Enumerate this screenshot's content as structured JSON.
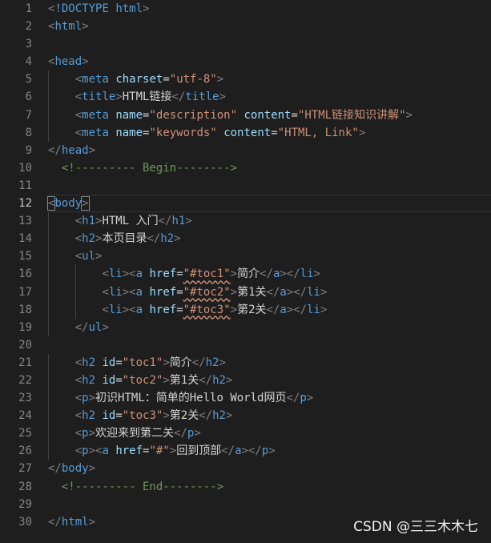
{
  "lines": [
    {
      "n": "1",
      "t": [
        [
          "punc",
          "<"
        ],
        [
          "doctype",
          "!DOCTYPE"
        ],
        [
          "txt",
          " "
        ],
        [
          "tag",
          "html"
        ],
        [
          "punc",
          ">"
        ]
      ]
    },
    {
      "n": "2",
      "t": [
        [
          "punc",
          "<"
        ],
        [
          "tag",
          "html"
        ],
        [
          "punc",
          ">"
        ]
      ]
    },
    {
      "n": "3",
      "t": []
    },
    {
      "n": "4",
      "t": [
        [
          "punc",
          "<"
        ],
        [
          "tag",
          "head"
        ],
        [
          "punc",
          ">"
        ]
      ]
    },
    {
      "n": "5",
      "t": [
        [
          "txt",
          "    "
        ],
        [
          "punc",
          "<"
        ],
        [
          "tag",
          "meta"
        ],
        [
          "txt",
          " "
        ],
        [
          "attr",
          "charset"
        ],
        [
          "txt",
          "="
        ],
        [
          "str",
          "\"utf-8\""
        ],
        [
          "punc",
          ">"
        ]
      ]
    },
    {
      "n": "6",
      "t": [
        [
          "txt",
          "    "
        ],
        [
          "punc",
          "<"
        ],
        [
          "tag",
          "title"
        ],
        [
          "punc",
          ">"
        ],
        [
          "txt",
          "HTML链接"
        ],
        [
          "punc",
          "</"
        ],
        [
          "tag",
          "title"
        ],
        [
          "punc",
          ">"
        ]
      ]
    },
    {
      "n": "7",
      "t": [
        [
          "txt",
          "    "
        ],
        [
          "punc",
          "<"
        ],
        [
          "tag",
          "meta"
        ],
        [
          "txt",
          " "
        ],
        [
          "attr",
          "name"
        ],
        [
          "txt",
          "="
        ],
        [
          "str",
          "\"description\""
        ],
        [
          "txt",
          " "
        ],
        [
          "attr",
          "content"
        ],
        [
          "txt",
          "="
        ],
        [
          "str",
          "\"HTML链接知识讲解\""
        ],
        [
          "punc",
          ">"
        ]
      ]
    },
    {
      "n": "8",
      "t": [
        [
          "txt",
          "    "
        ],
        [
          "punc",
          "<"
        ],
        [
          "tag",
          "meta"
        ],
        [
          "txt",
          " "
        ],
        [
          "attr",
          "name"
        ],
        [
          "txt",
          "="
        ],
        [
          "str",
          "\"keywords\""
        ],
        [
          "txt",
          " "
        ],
        [
          "attr",
          "content"
        ],
        [
          "txt",
          "="
        ],
        [
          "str",
          "\"HTML, Link\""
        ],
        [
          "punc",
          ">"
        ]
      ]
    },
    {
      "n": "9",
      "t": [
        [
          "punc",
          "</"
        ],
        [
          "tag",
          "head"
        ],
        [
          "punc",
          ">"
        ]
      ]
    },
    {
      "n": "10",
      "t": [
        [
          "txt",
          "  "
        ],
        [
          "cmt",
          "<!--------- Begin-------->"
        ]
      ]
    },
    {
      "n": "11",
      "t": []
    },
    {
      "n": "12",
      "active": true,
      "t": [
        [
          "punc bracket-hl",
          "<"
        ],
        [
          "tag",
          "body"
        ],
        [
          "punc bracket-hl",
          ">"
        ]
      ]
    },
    {
      "n": "13",
      "t": [
        [
          "txt",
          "    "
        ],
        [
          "punc",
          "<"
        ],
        [
          "tag",
          "h1"
        ],
        [
          "punc",
          ">"
        ],
        [
          "txt",
          "HTML 入门"
        ],
        [
          "punc",
          "</"
        ],
        [
          "tag",
          "h1"
        ],
        [
          "punc",
          ">"
        ]
      ]
    },
    {
      "n": "14",
      "t": [
        [
          "txt",
          "    "
        ],
        [
          "punc",
          "<"
        ],
        [
          "tag",
          "h2"
        ],
        [
          "punc",
          ">"
        ],
        [
          "txt",
          "本页目录"
        ],
        [
          "punc",
          "</"
        ],
        [
          "tag",
          "h2"
        ],
        [
          "punc",
          ">"
        ]
      ]
    },
    {
      "n": "15",
      "t": [
        [
          "txt",
          "    "
        ],
        [
          "punc",
          "<"
        ],
        [
          "tag",
          "ul"
        ],
        [
          "punc",
          ">"
        ]
      ]
    },
    {
      "n": "16",
      "t": [
        [
          "txt",
          "        "
        ],
        [
          "punc",
          "<"
        ],
        [
          "tag",
          "li"
        ],
        [
          "punc",
          "><"
        ],
        [
          "tag",
          "a"
        ],
        [
          "txt",
          " "
        ],
        [
          "attr",
          "href"
        ],
        [
          "txt",
          "="
        ],
        [
          "str squig",
          "\"#toc1\""
        ],
        [
          "punc",
          ">"
        ],
        [
          "txt",
          "简介"
        ],
        [
          "punc",
          "</"
        ],
        [
          "tag",
          "a"
        ],
        [
          "punc",
          "></"
        ],
        [
          "tag",
          "li"
        ],
        [
          "punc",
          ">"
        ]
      ]
    },
    {
      "n": "17",
      "t": [
        [
          "txt",
          "        "
        ],
        [
          "punc",
          "<"
        ],
        [
          "tag",
          "li"
        ],
        [
          "punc",
          "><"
        ],
        [
          "tag",
          "a"
        ],
        [
          "txt",
          " "
        ],
        [
          "attr",
          "href"
        ],
        [
          "txt",
          "="
        ],
        [
          "str squig",
          "\"#toc2\""
        ],
        [
          "punc",
          ">"
        ],
        [
          "txt",
          "第1关"
        ],
        [
          "punc",
          "</"
        ],
        [
          "tag",
          "a"
        ],
        [
          "punc",
          "></"
        ],
        [
          "tag",
          "li"
        ],
        [
          "punc",
          ">"
        ]
      ]
    },
    {
      "n": "18",
      "t": [
        [
          "txt",
          "        "
        ],
        [
          "punc",
          "<"
        ],
        [
          "tag",
          "li"
        ],
        [
          "punc",
          "><"
        ],
        [
          "tag",
          "a"
        ],
        [
          "txt",
          " "
        ],
        [
          "attr",
          "href"
        ],
        [
          "txt",
          "="
        ],
        [
          "str squig",
          "\"#toc3\""
        ],
        [
          "punc",
          ">"
        ],
        [
          "txt",
          "第2关"
        ],
        [
          "punc",
          "</"
        ],
        [
          "tag",
          "a"
        ],
        [
          "punc",
          "></"
        ],
        [
          "tag",
          "li"
        ],
        [
          "punc",
          ">"
        ]
      ]
    },
    {
      "n": "19",
      "t": [
        [
          "txt",
          "    "
        ],
        [
          "punc",
          "</"
        ],
        [
          "tag",
          "ul"
        ],
        [
          "punc",
          ">"
        ]
      ]
    },
    {
      "n": "20",
      "t": []
    },
    {
      "n": "21",
      "t": [
        [
          "txt",
          "    "
        ],
        [
          "punc",
          "<"
        ],
        [
          "tag",
          "h2"
        ],
        [
          "txt",
          " "
        ],
        [
          "attr",
          "id"
        ],
        [
          "txt",
          "="
        ],
        [
          "str",
          "\"toc1\""
        ],
        [
          "punc",
          ">"
        ],
        [
          "txt",
          "简介"
        ],
        [
          "punc",
          "</"
        ],
        [
          "tag",
          "h2"
        ],
        [
          "punc",
          ">"
        ]
      ]
    },
    {
      "n": "22",
      "t": [
        [
          "txt",
          "    "
        ],
        [
          "punc",
          "<"
        ],
        [
          "tag",
          "h2"
        ],
        [
          "txt",
          " "
        ],
        [
          "attr",
          "id"
        ],
        [
          "txt",
          "="
        ],
        [
          "str",
          "\"toc2\""
        ],
        [
          "punc",
          ">"
        ],
        [
          "txt",
          "第1关"
        ],
        [
          "punc",
          "</"
        ],
        [
          "tag",
          "h2"
        ],
        [
          "punc",
          ">"
        ]
      ]
    },
    {
      "n": "23",
      "t": [
        [
          "txt",
          "    "
        ],
        [
          "punc",
          "<"
        ],
        [
          "tag",
          "p"
        ],
        [
          "punc",
          ">"
        ],
        [
          "txt",
          "初识HTML：简单的Hello World网页"
        ],
        [
          "punc",
          "</"
        ],
        [
          "tag",
          "p"
        ],
        [
          "punc",
          ">"
        ]
      ]
    },
    {
      "n": "24",
      "t": [
        [
          "txt",
          "    "
        ],
        [
          "punc",
          "<"
        ],
        [
          "tag",
          "h2"
        ],
        [
          "txt",
          " "
        ],
        [
          "attr",
          "id"
        ],
        [
          "txt",
          "="
        ],
        [
          "str",
          "\"toc3\""
        ],
        [
          "punc",
          ">"
        ],
        [
          "txt",
          "第2关"
        ],
        [
          "punc",
          "</"
        ],
        [
          "tag",
          "h2"
        ],
        [
          "punc",
          ">"
        ]
      ]
    },
    {
      "n": "25",
      "t": [
        [
          "txt",
          "    "
        ],
        [
          "punc",
          "<"
        ],
        [
          "tag",
          "p"
        ],
        [
          "punc",
          ">"
        ],
        [
          "txt",
          "欢迎来到第二关"
        ],
        [
          "punc",
          "</"
        ],
        [
          "tag",
          "p"
        ],
        [
          "punc",
          ">"
        ]
      ]
    },
    {
      "n": "26",
      "t": [
        [
          "txt",
          "    "
        ],
        [
          "punc",
          "<"
        ],
        [
          "tag",
          "p"
        ],
        [
          "punc",
          "><"
        ],
        [
          "tag",
          "a"
        ],
        [
          "txt",
          " "
        ],
        [
          "attr",
          "href"
        ],
        [
          "txt",
          "="
        ],
        [
          "str",
          "\"#\""
        ],
        [
          "punc",
          ">"
        ],
        [
          "txt",
          "回到顶部"
        ],
        [
          "punc",
          "</"
        ],
        [
          "tag",
          "a"
        ],
        [
          "punc",
          "></"
        ],
        [
          "tag",
          "p"
        ],
        [
          "punc",
          ">"
        ]
      ]
    },
    {
      "n": "27",
      "t": [
        [
          "punc",
          "</"
        ],
        [
          "tag",
          "body"
        ],
        [
          "punc",
          ">"
        ]
      ]
    },
    {
      "n": "28",
      "t": [
        [
          "txt",
          "  "
        ],
        [
          "cmt",
          "<!--------- End-------->"
        ]
      ]
    },
    {
      "n": "29",
      "t": []
    },
    {
      "n": "30",
      "t": [
        [
          "punc",
          "</"
        ],
        [
          "tag",
          "html"
        ],
        [
          "punc",
          ">"
        ]
      ]
    }
  ],
  "watermark": "CSDN @三三木木七"
}
